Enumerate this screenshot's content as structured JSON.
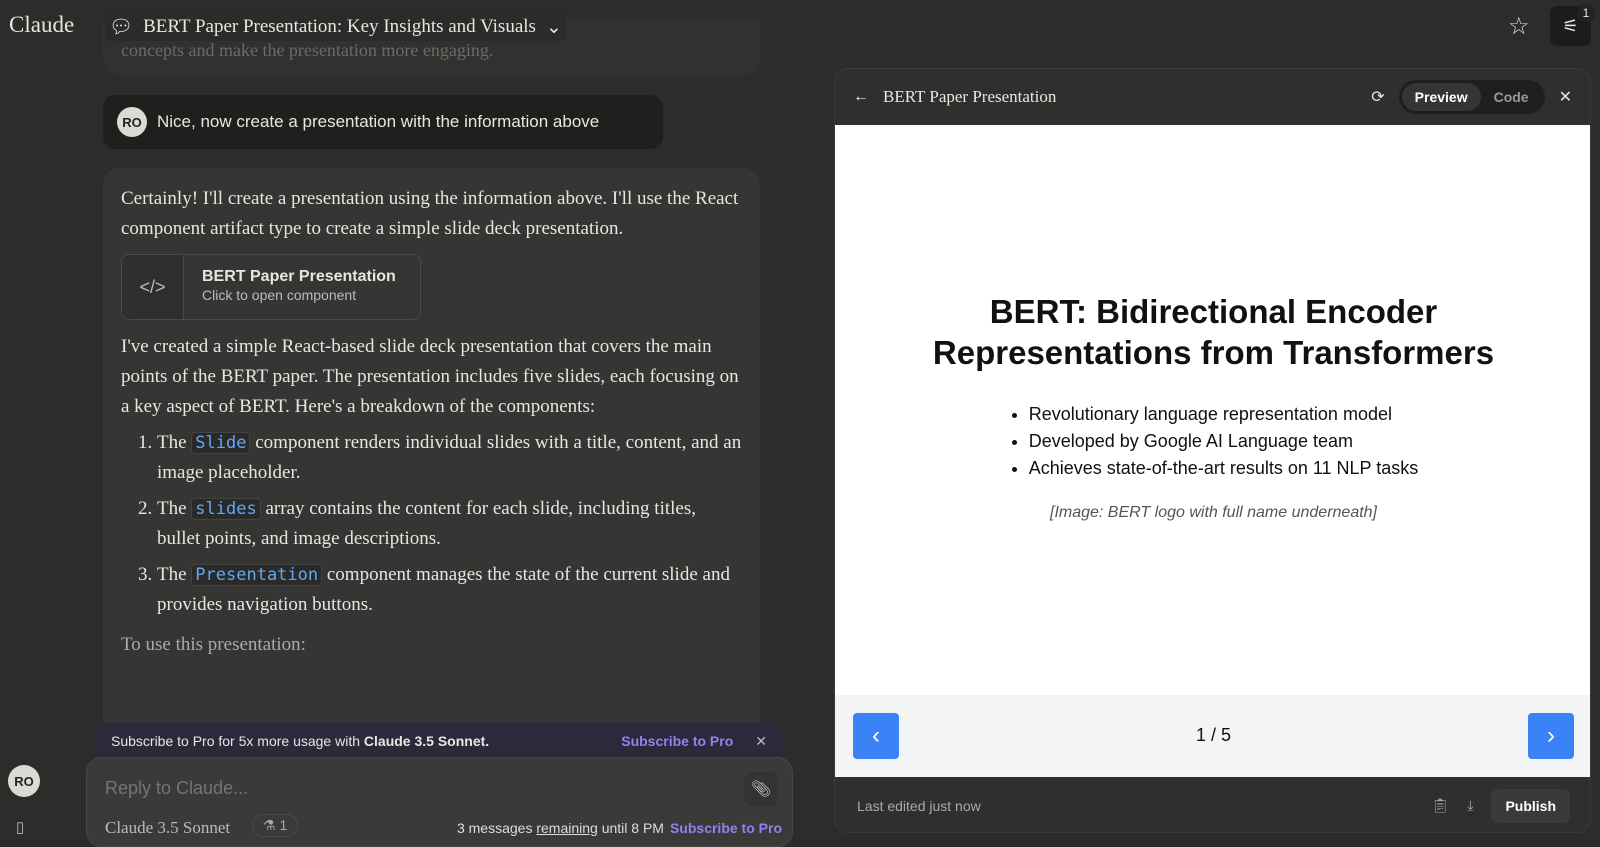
{
  "app": {
    "logo": "Claude",
    "conversation_title": "BERT Paper Presentation: Key Insights and Visuals",
    "settings_badge": "1"
  },
  "chat": {
    "previous_fragment": "concepts and make the presentation more engaging.",
    "user_initials": "RO",
    "user_message": "Nice, now create a presentation with the information above",
    "assistant": {
      "intro": "Certainly! I'll create a presentation using the information above. I'll use the React component artifact type to create a simple slide deck presentation.",
      "artifact_title": "BERT Paper Presentation",
      "artifact_subtitle": "Click to open component",
      "para": "I've created a simple React-based slide deck presentation that covers the main points of the BERT paper. The presentation includes five slides, each focusing on a key aspect of BERT. Here's a breakdown of the components:",
      "items": [
        {
          "pre": "The ",
          "code": "Slide",
          "post": " component renders individual slides with a title, content, and an image placeholder."
        },
        {
          "pre": "The ",
          "code": "slides",
          "post": " array contains the content for each slide, including titles, bullet points, and image descriptions."
        },
        {
          "pre": "The ",
          "code": "Presentation",
          "post": " component manages the state of the current slide and provides navigation buttons."
        }
      ],
      "trailing": "To use this presentation:"
    }
  },
  "banner": {
    "text_prefix": "Subscribe to Pro for 5x more usage with ",
    "text_bold": "Claude 3.5 Sonnet.",
    "link": "Subscribe to Pro"
  },
  "composer": {
    "placeholder": "Reply to Claude...",
    "model": "Claude 3.5 Sonnet",
    "flask_count": "1",
    "remaining_prefix": "3 messages ",
    "remaining_link": "remaining",
    "remaining_suffix": " until 8 PM",
    "subscribe": "Subscribe to Pro"
  },
  "panel": {
    "title": "BERT Paper Presentation",
    "tabs": [
      "Preview",
      "Code"
    ],
    "active_tab": "Preview",
    "slide": {
      "title": "BERT: Bidirectional Encoder Representations from Transformers",
      "bullets": [
        "Revolutionary language representation model",
        "Developed by Google AI Language team",
        "Achieves state-of-the-art results on 11 NLP tasks"
      ],
      "image": "[Image: BERT logo with full name underneath]"
    },
    "page": "1 / 5",
    "last_edited": "Last edited just now",
    "publish": "Publish"
  },
  "colors": {
    "accent_blue": "#3b82f6",
    "pro_purple": "#8f83f0"
  }
}
